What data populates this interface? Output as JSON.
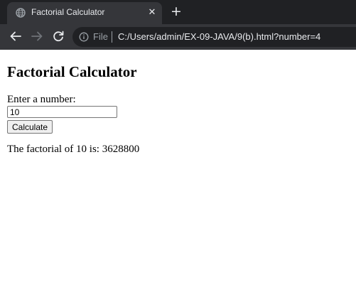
{
  "browser": {
    "tab": {
      "title": "Factorial Calculator",
      "favicon_icon": "globe-icon",
      "close_icon": "close-icon",
      "close_glyph": "✕"
    },
    "new_tab": {
      "icon": "plus-icon",
      "glyph": "+"
    },
    "nav": {
      "back_icon": "arrow-left-icon",
      "forward_icon": "arrow-right-icon",
      "reload_icon": "reload-icon"
    },
    "address_bar": {
      "info_icon": "info-icon",
      "scheme_label": "File",
      "url": "C:/Users/admin/EX-09-JAVA/9(b).html?number=4"
    },
    "colors": {
      "frame": "#202124",
      "toolbar": "#35363a",
      "text": "#e8eaed",
      "muted": "#9aa0a6"
    }
  },
  "page": {
    "heading": "Factorial Calculator",
    "form": {
      "label": "Enter a number:",
      "input_value": "10",
      "button_label": "Calculate"
    },
    "result": "The factorial of 10 is: 3628800"
  }
}
